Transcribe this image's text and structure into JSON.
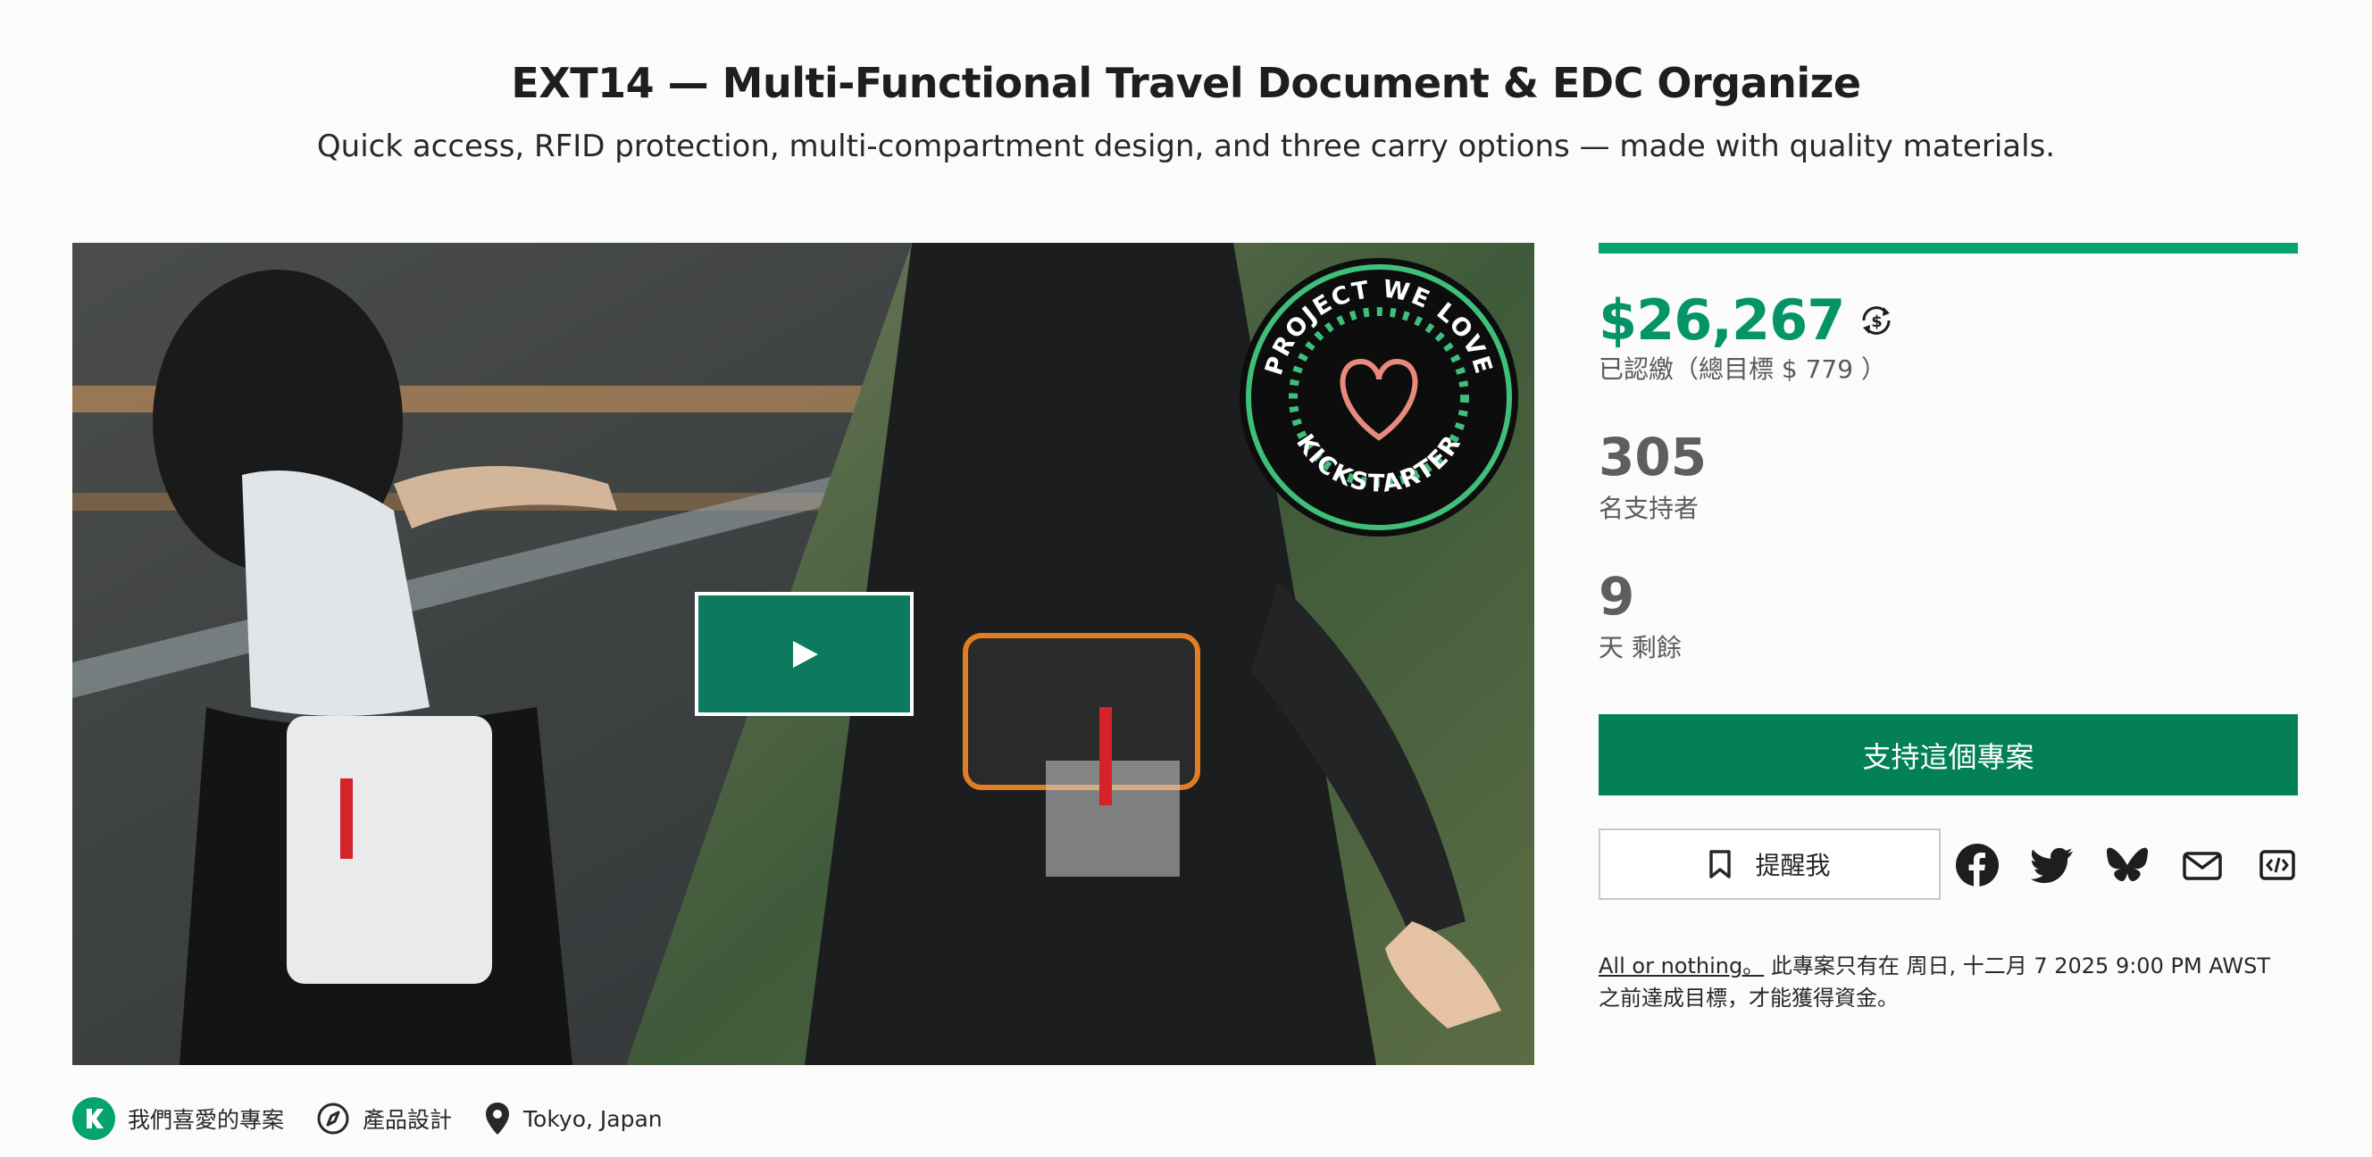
{
  "header": {
    "title": "EXT14 — Multi-Functional Travel Document & EDC Organize",
    "subtitle": "Quick access, RFID protection, multi-compartment design, and three carry options — made with quality materials."
  },
  "hero": {
    "badge": {
      "top_text": "PROJECT WE LOVE",
      "bottom_text": "KICKSTARTER"
    },
    "play_icon": "play-icon"
  },
  "meta": {
    "tags": [
      {
        "icon": "kickstarter-k-icon",
        "label": "我們喜愛的專案"
      },
      {
        "icon": "compass-icon",
        "label": "產品設計"
      },
      {
        "icon": "map-pin-icon",
        "label": "Tokyo, Japan"
      }
    ]
  },
  "campaign": {
    "progress_fraction": 1.0,
    "pledged": "$26,267",
    "pledged_label": "已認繳（總目標 $ 779 ）",
    "backers": "305",
    "backers_label": "名支持者",
    "days": "9",
    "days_label": "天 剩餘",
    "back_button": "支持這個專案",
    "remind_button": "提醒我",
    "share_icons": [
      "facebook-icon",
      "twitter-icon",
      "bluesky-icon",
      "email-icon",
      "embed-icon"
    ],
    "note_link": "All or nothing。",
    "note_text": " 此專案只有在 周日, 十二月 7 2025 9:00 PM AWST 之前達成目標，才能獲得資金。"
  },
  "colors": {
    "accent": "#05a36e",
    "button": "#048154",
    "play": "#0b7a5e"
  }
}
